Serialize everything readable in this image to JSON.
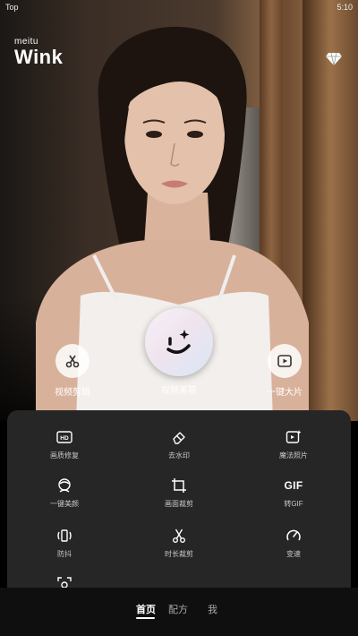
{
  "status_bar": {
    "left": "Top",
    "time": "5:10"
  },
  "app": {
    "brand": "meitu",
    "name": "Wink"
  },
  "icons": {
    "vip": "diamond-icon",
    "clip": "scissors-icon",
    "beauty": "smile-sparkle-icon",
    "film": "play-icon"
  },
  "hero_buttons": {
    "clip": "视频剪辑",
    "beauty": "视频美容",
    "film": "一键大片"
  },
  "tools": [
    {
      "label": "画质修复",
      "icon": "hd-icon"
    },
    {
      "label": "去水印",
      "icon": "eraser-icon"
    },
    {
      "label": "魔法照片",
      "icon": "magic-photo-icon"
    },
    {
      "label": "一键美颜",
      "icon": "face-beauty-icon"
    },
    {
      "label": "画面裁剪",
      "icon": "crop-icon"
    },
    {
      "label": "转GIF",
      "icon": "gif-icon",
      "glyph": "GIF"
    },
    {
      "label": "防抖",
      "icon": "stabilize-icon"
    },
    {
      "label": "时长裁剪",
      "icon": "scissors-icon"
    },
    {
      "label": "变速",
      "icon": "speed-icon"
    }
  ],
  "bottom_nav": {
    "home": "首页",
    "recipe": "配方",
    "me": "我"
  },
  "colors": {
    "panel": "#262626",
    "nav_bg": "#0f0f0f",
    "accent": "#ffffff"
  }
}
